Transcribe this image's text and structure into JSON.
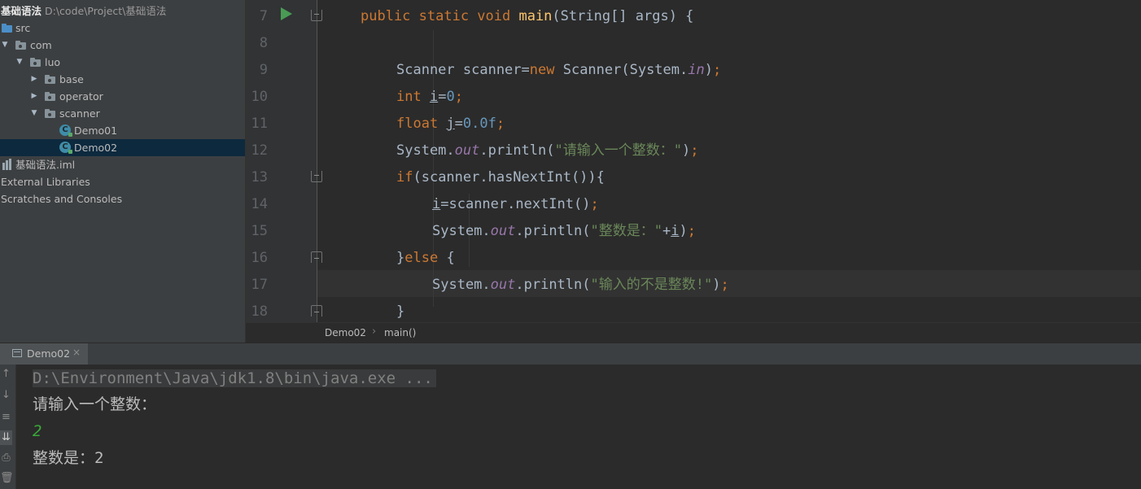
{
  "project": {
    "name": "基础语法",
    "path": "D:\\code\\Project\\基础语法"
  },
  "tree": {
    "src": "src",
    "com": "com",
    "luo": "luo",
    "base": "base",
    "operator": "operator",
    "scanner": "scanner",
    "demo01": "Demo01",
    "demo02": "Demo02",
    "iml": "基础语法.iml",
    "external_libraries": "External Libraries",
    "scratches": "Scratches and Consoles"
  },
  "editor": {
    "line_numbers": [
      "7",
      "8",
      "9",
      "10",
      "11",
      "12",
      "13",
      "14",
      "15",
      "16",
      "17",
      "18"
    ],
    "current_line": "17"
  },
  "breadcrumbs": {
    "class": "Demo02",
    "method": "main()"
  },
  "run_panel": {
    "tab_label": "Demo02",
    "close_glyph": "×"
  },
  "console": {
    "command": "D:\\Environment\\Java\\jdk1.8\\bin\\java.exe ...",
    "prompt": "请输入一个整数：",
    "user_input": "2",
    "result": "整数是：2"
  },
  "colors": {
    "editor_bg": "#2b2b2b",
    "panel_bg": "#3c3f41",
    "keyword": "#cc7832",
    "function": "#ffc66d",
    "number": "#6897bb",
    "string": "#6a8759",
    "field": "#9876aa",
    "user_input": "#39aa38",
    "run_green": "#499c54"
  },
  "icons": {
    "run": "run-triangle-icon",
    "folder": "folder-icon",
    "class": "java-class-icon",
    "module_file": "iml-file-icon"
  }
}
